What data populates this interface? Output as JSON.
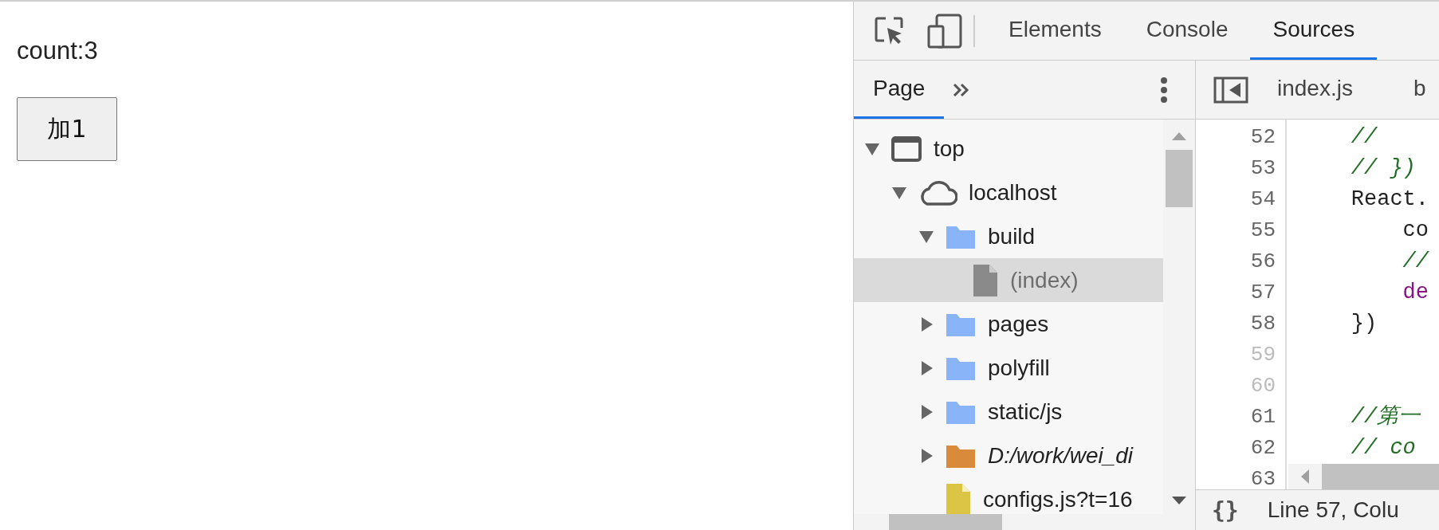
{
  "page": {
    "counter_text": "count:3",
    "button": "加1"
  },
  "devtools": {
    "tabs": [
      {
        "label": "Elements",
        "selected": false
      },
      {
        "label": "Console",
        "selected": false
      },
      {
        "label": "Sources",
        "selected": true
      }
    ],
    "navigator": {
      "tabs": [
        {
          "label": "Page",
          "selected": true
        }
      ],
      "tree": [
        {
          "label": "top",
          "kind": "frame",
          "expanded": true,
          "selected": false,
          "children": [
            {
              "label": "localhost",
              "kind": "domain",
              "expanded": true,
              "selected": false,
              "children": [
                {
                  "label": "build",
                  "kind": "folder",
                  "expanded": true,
                  "selected": false,
                  "children": [
                    {
                      "label": "(index)",
                      "kind": "document",
                      "selected": true
                    }
                  ]
                },
                {
                  "label": "pages",
                  "kind": "folder",
                  "expanded": false,
                  "selected": false
                },
                {
                  "label": "polyfill",
                  "kind": "folder",
                  "expanded": false,
                  "selected": false
                },
                {
                  "label": "static/js",
                  "kind": "folder",
                  "expanded": false,
                  "selected": false
                },
                {
                  "label": "D:/work/wei_di",
                  "kind": "fs-folder",
                  "expanded": false,
                  "selected": false
                },
                {
                  "label": "configs.js?t=16",
                  "kind": "script",
                  "selected": false
                }
              ]
            }
          ]
        }
      ]
    },
    "editor": {
      "tabs": [
        "index.js",
        "b"
      ],
      "lines": [
        {
          "number": "52",
          "dim": false,
          "kind": "comment",
          "text": "    //"
        },
        {
          "number": "53",
          "dim": false,
          "kind": "comment",
          "text": "    // })"
        },
        {
          "number": "54",
          "dim": false,
          "kind": "plain",
          "text": "    React."
        },
        {
          "number": "55",
          "dim": false,
          "kind": "plain",
          "text": "        co"
        },
        {
          "number": "56",
          "dim": false,
          "kind": "comment",
          "text": "        //"
        },
        {
          "number": "57",
          "dim": false,
          "kind": "keyword",
          "text": "        de"
        },
        {
          "number": "58",
          "dim": false,
          "kind": "plain",
          "text": "    })"
        },
        {
          "number": "59",
          "dim": true
        },
        {
          "number": "60",
          "dim": true
        },
        {
          "number": "61",
          "dim": false,
          "kind": "comment",
          "text": "    //第一"
        },
        {
          "number": "62",
          "dim": false,
          "kind": "comment",
          "text": "    // co"
        },
        {
          "number": "63",
          "dim": false
        }
      ],
      "status": {
        "format_icon": "{}",
        "position": "Line 57, Colu"
      }
    }
  }
}
